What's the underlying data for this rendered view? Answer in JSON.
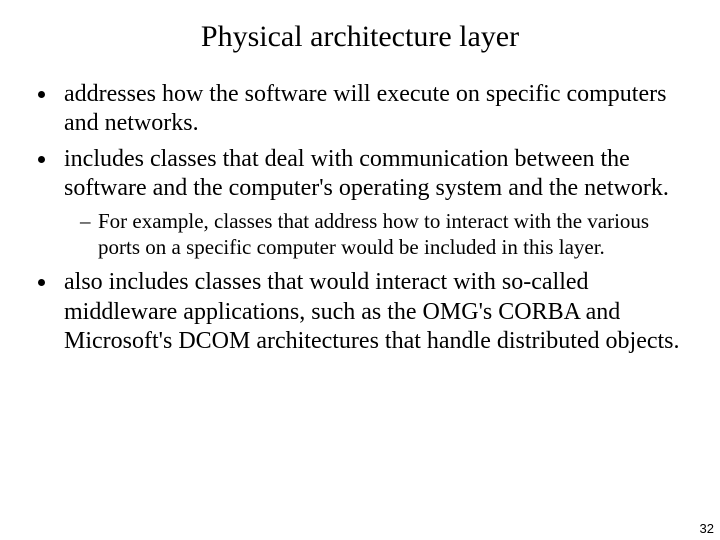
{
  "title": "Physical architecture layer",
  "bullets": {
    "b1": "addresses how the software will execute on specific computers and networks.",
    "b2": "includes classes that deal with communication between the software and the computer's operating system and the network.",
    "b2_sub1": "For example, classes that address how to interact with the various ports on a specific computer would be included in this layer.",
    "b3": "also includes classes that would interact with so-called middleware applications, such as the OMG's CORBA and Microsoft's DCOM architectures that handle distributed objects."
  },
  "page_number": "32"
}
